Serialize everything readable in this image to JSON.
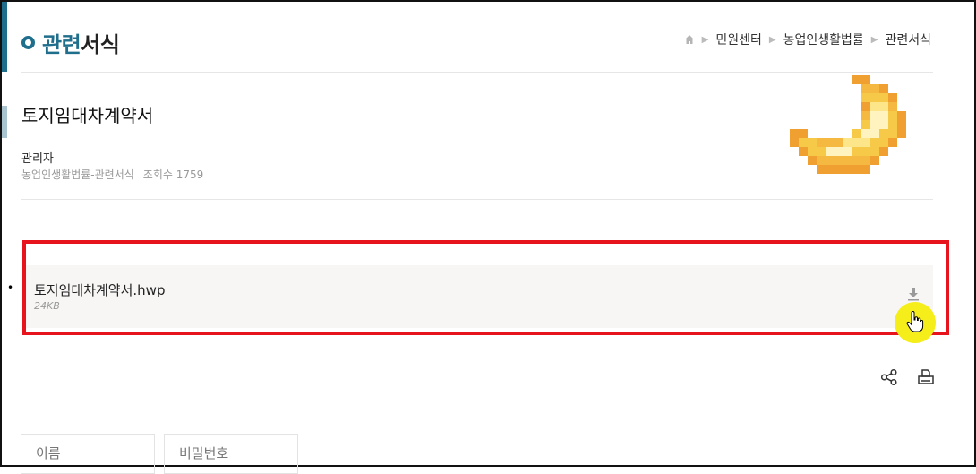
{
  "header": {
    "title_accent": "관련",
    "title_rest": "서식",
    "breadcrumb": [
      "민원센터",
      "농업인생활법률",
      "관련서식"
    ]
  },
  "post": {
    "title": "토지임대차계약서",
    "author": "관리자",
    "category": "농업인생활법률-관련서식",
    "views_label": "조회수",
    "views": "1759"
  },
  "attachment": {
    "bullet": "•",
    "file_name": "토지임대차계약서.hwp",
    "file_size": "24KB"
  },
  "form": {
    "name_placeholder": "이름",
    "password_placeholder": "비밀번호"
  },
  "colors": {
    "accent": "#1f6e8c",
    "highlight_border": "#e8141d",
    "cursor_spot": "#f5ee1a"
  },
  "icons": [
    "home-icon",
    "download-icon",
    "share-icon",
    "print-icon",
    "pointer-hand-icon",
    "banana-sticker-icon"
  ]
}
